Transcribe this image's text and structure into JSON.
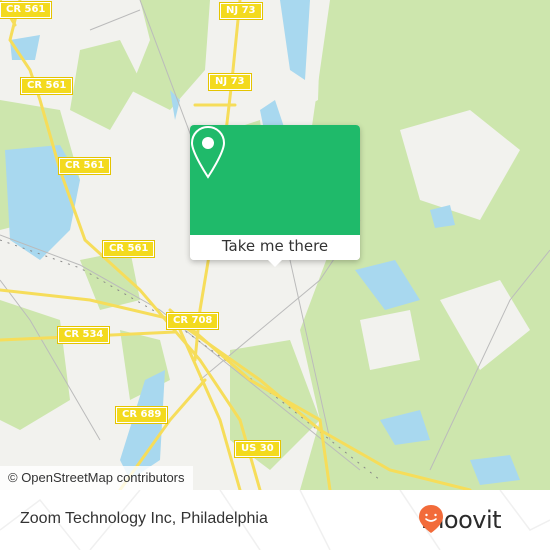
{
  "map": {
    "attribution": "© OpenStreetMap contributors",
    "road_labels": [
      {
        "text": "CR 561"
      },
      {
        "text": "CR 561"
      },
      {
        "text": "CR 561"
      },
      {
        "text": "CR 561"
      },
      {
        "text": "NJ 73"
      },
      {
        "text": "NJ 73"
      },
      {
        "text": "CR 708"
      },
      {
        "text": "CR 534"
      },
      {
        "text": "CR 689"
      },
      {
        "text": "US 30"
      }
    ],
    "colors": {
      "land": "#f2f2ee",
      "forest": "#cde6ad",
      "water": "#a8d8ef",
      "road": "#f6dd5a",
      "popup_green": "#1fba6a"
    }
  },
  "popup": {
    "icon": "map-pin-icon",
    "button_label": "Take me there"
  },
  "footer": {
    "place_name": "Zoom Technology Inc, Philadelphia",
    "brand": "moovit",
    "brand_color": "#f26b3a"
  }
}
